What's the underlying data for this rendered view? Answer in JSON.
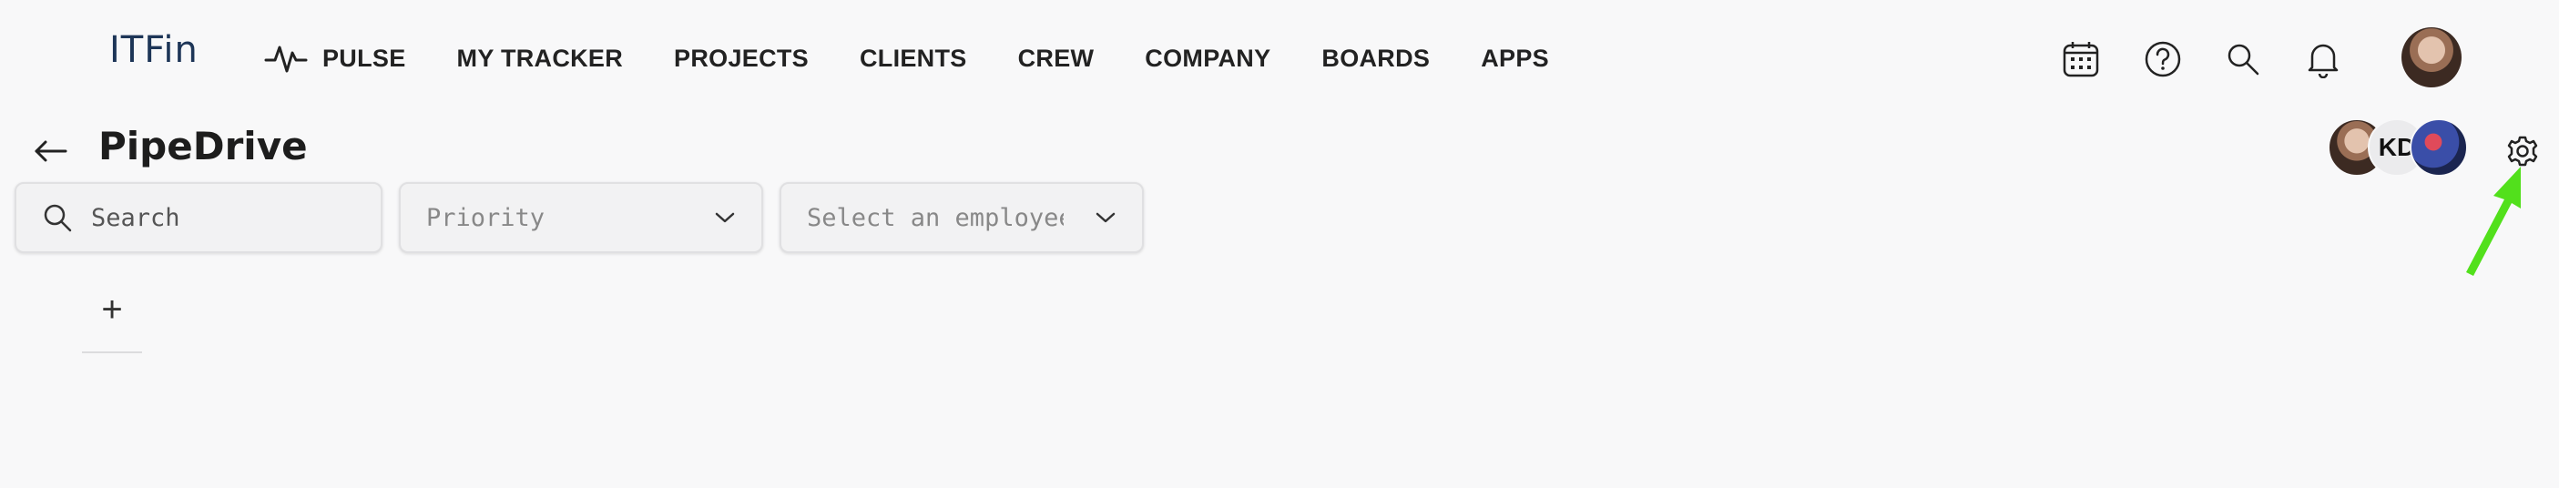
{
  "app": {
    "logo": "ITFin"
  },
  "nav": [
    {
      "label": "PULSE",
      "icon": "pulse-icon"
    },
    {
      "label": "MY TRACKER"
    },
    {
      "label": "PROJECTS"
    },
    {
      "label": "CLIENTS"
    },
    {
      "label": "CREW"
    },
    {
      "label": "COMPANY"
    },
    {
      "label": "BOARDS"
    },
    {
      "label": "APPS"
    }
  ],
  "top_icons": [
    "calendar-icon",
    "help-icon",
    "search-icon",
    "bell-icon"
  ],
  "page": {
    "title": "PipeDrive"
  },
  "team": [
    {
      "name": "avatar-photo"
    },
    {
      "initials": "KD"
    },
    {
      "name": "avatar-photo-2"
    }
  ],
  "filters": {
    "search_placeholder": "Search",
    "priority_placeholder": "Priority",
    "employee_placeholder": "Select an employee"
  },
  "add_label": "+",
  "colors": {
    "logo": "#1d3557",
    "arrow": "#52e01c",
    "background": "#f8f8f9"
  }
}
